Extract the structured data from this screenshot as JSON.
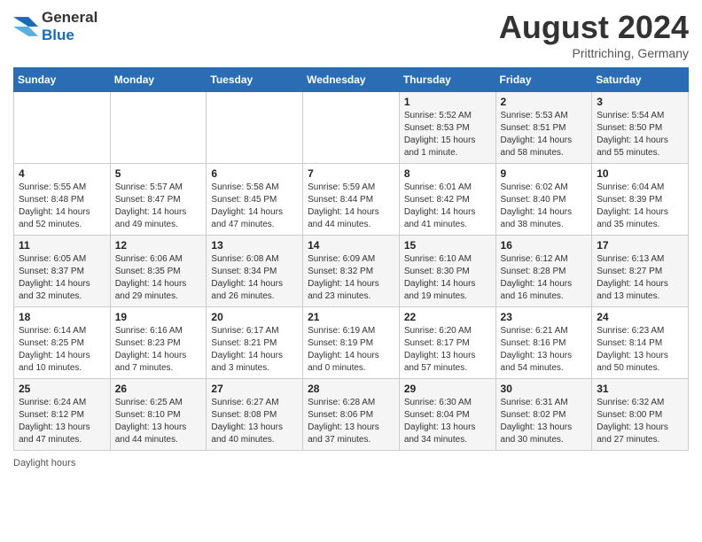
{
  "header": {
    "logo": {
      "general": "General",
      "blue": "Blue"
    },
    "title": "August 2024",
    "location": "Prittriching, Germany"
  },
  "calendar": {
    "weekdays": [
      "Sunday",
      "Monday",
      "Tuesday",
      "Wednesday",
      "Thursday",
      "Friday",
      "Saturday"
    ],
    "weeks": [
      [
        {
          "day": "",
          "info": ""
        },
        {
          "day": "",
          "info": ""
        },
        {
          "day": "",
          "info": ""
        },
        {
          "day": "",
          "info": ""
        },
        {
          "day": "1",
          "info": "Sunrise: 5:52 AM\nSunset: 8:53 PM\nDaylight: 15 hours and 1 minute."
        },
        {
          "day": "2",
          "info": "Sunrise: 5:53 AM\nSunset: 8:51 PM\nDaylight: 14 hours and 58 minutes."
        },
        {
          "day": "3",
          "info": "Sunrise: 5:54 AM\nSunset: 8:50 PM\nDaylight: 14 hours and 55 minutes."
        }
      ],
      [
        {
          "day": "4",
          "info": "Sunrise: 5:55 AM\nSunset: 8:48 PM\nDaylight: 14 hours and 52 minutes."
        },
        {
          "day": "5",
          "info": "Sunrise: 5:57 AM\nSunset: 8:47 PM\nDaylight: 14 hours and 49 minutes."
        },
        {
          "day": "6",
          "info": "Sunrise: 5:58 AM\nSunset: 8:45 PM\nDaylight: 14 hours and 47 minutes."
        },
        {
          "day": "7",
          "info": "Sunrise: 5:59 AM\nSunset: 8:44 PM\nDaylight: 14 hours and 44 minutes."
        },
        {
          "day": "8",
          "info": "Sunrise: 6:01 AM\nSunset: 8:42 PM\nDaylight: 14 hours and 41 minutes."
        },
        {
          "day": "9",
          "info": "Sunrise: 6:02 AM\nSunset: 8:40 PM\nDaylight: 14 hours and 38 minutes."
        },
        {
          "day": "10",
          "info": "Sunrise: 6:04 AM\nSunset: 8:39 PM\nDaylight: 14 hours and 35 minutes."
        }
      ],
      [
        {
          "day": "11",
          "info": "Sunrise: 6:05 AM\nSunset: 8:37 PM\nDaylight: 14 hours and 32 minutes."
        },
        {
          "day": "12",
          "info": "Sunrise: 6:06 AM\nSunset: 8:35 PM\nDaylight: 14 hours and 29 minutes."
        },
        {
          "day": "13",
          "info": "Sunrise: 6:08 AM\nSunset: 8:34 PM\nDaylight: 14 hours and 26 minutes."
        },
        {
          "day": "14",
          "info": "Sunrise: 6:09 AM\nSunset: 8:32 PM\nDaylight: 14 hours and 23 minutes."
        },
        {
          "day": "15",
          "info": "Sunrise: 6:10 AM\nSunset: 8:30 PM\nDaylight: 14 hours and 19 minutes."
        },
        {
          "day": "16",
          "info": "Sunrise: 6:12 AM\nSunset: 8:28 PM\nDaylight: 14 hours and 16 minutes."
        },
        {
          "day": "17",
          "info": "Sunrise: 6:13 AM\nSunset: 8:27 PM\nDaylight: 14 hours and 13 minutes."
        }
      ],
      [
        {
          "day": "18",
          "info": "Sunrise: 6:14 AM\nSunset: 8:25 PM\nDaylight: 14 hours and 10 minutes."
        },
        {
          "day": "19",
          "info": "Sunrise: 6:16 AM\nSunset: 8:23 PM\nDaylight: 14 hours and 7 minutes."
        },
        {
          "day": "20",
          "info": "Sunrise: 6:17 AM\nSunset: 8:21 PM\nDaylight: 14 hours and 3 minutes."
        },
        {
          "day": "21",
          "info": "Sunrise: 6:19 AM\nSunset: 8:19 PM\nDaylight: 14 hours and 0 minutes."
        },
        {
          "day": "22",
          "info": "Sunrise: 6:20 AM\nSunset: 8:17 PM\nDaylight: 13 hours and 57 minutes."
        },
        {
          "day": "23",
          "info": "Sunrise: 6:21 AM\nSunset: 8:16 PM\nDaylight: 13 hours and 54 minutes."
        },
        {
          "day": "24",
          "info": "Sunrise: 6:23 AM\nSunset: 8:14 PM\nDaylight: 13 hours and 50 minutes."
        }
      ],
      [
        {
          "day": "25",
          "info": "Sunrise: 6:24 AM\nSunset: 8:12 PM\nDaylight: 13 hours and 47 minutes."
        },
        {
          "day": "26",
          "info": "Sunrise: 6:25 AM\nSunset: 8:10 PM\nDaylight: 13 hours and 44 minutes."
        },
        {
          "day": "27",
          "info": "Sunrise: 6:27 AM\nSunset: 8:08 PM\nDaylight: 13 hours and 40 minutes."
        },
        {
          "day": "28",
          "info": "Sunrise: 6:28 AM\nSunset: 8:06 PM\nDaylight: 13 hours and 37 minutes."
        },
        {
          "day": "29",
          "info": "Sunrise: 6:30 AM\nSunset: 8:04 PM\nDaylight: 13 hours and 34 minutes."
        },
        {
          "day": "30",
          "info": "Sunrise: 6:31 AM\nSunset: 8:02 PM\nDaylight: 13 hours and 30 minutes."
        },
        {
          "day": "31",
          "info": "Sunrise: 6:32 AM\nSunset: 8:00 PM\nDaylight: 13 hours and 27 minutes."
        }
      ]
    ]
  },
  "footer": {
    "label": "Daylight hours"
  }
}
